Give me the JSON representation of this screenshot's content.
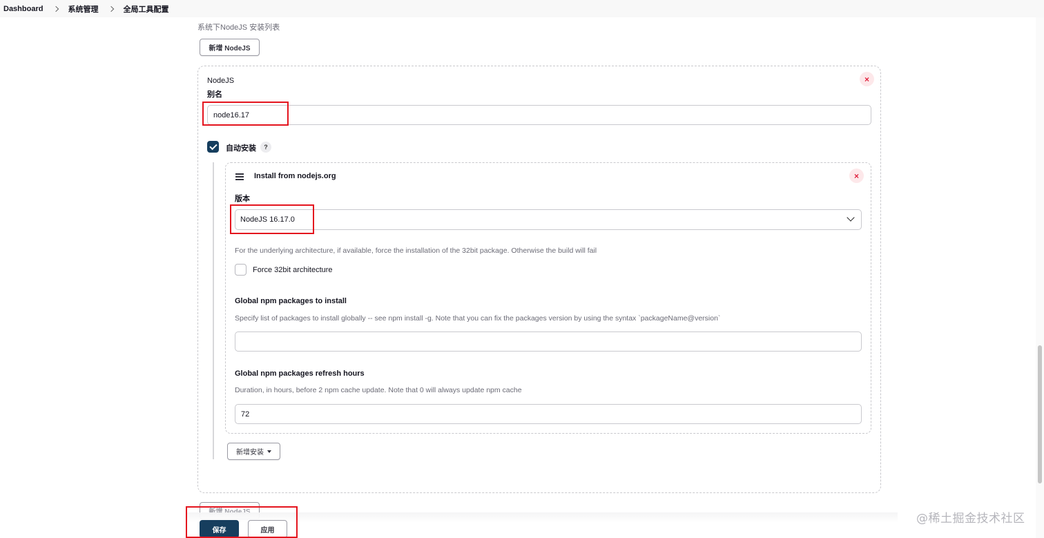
{
  "breadcrumb": {
    "items": [
      "Dashboard",
      "系统管理",
      "全局工具配置"
    ]
  },
  "section": {
    "description": "系统下NodeJS 安装列表",
    "add_button_label": "新增 NodeJS"
  },
  "nodejs_card": {
    "type_label": "NodeJS",
    "alias_label": "别名",
    "alias_value": "node16.17",
    "remove_symbol": "×",
    "auto_install_label": "自动安装",
    "help_symbol": "?"
  },
  "installer": {
    "title": "Install from nodejs.org",
    "remove_symbol": "×",
    "version_label": "版本",
    "version_selected": "NodeJS 16.17.0",
    "arch_description": "For the underlying architecture, if available, force the installation of the 32bit package. Otherwise the build will fail",
    "force32_label": "Force 32bit architecture",
    "force32_checked": false,
    "npm_packages_label": "Global npm packages to install",
    "npm_packages_description": "Specify list of packages to install globally -- see npm install -g. Note that you can fix the packages version by using the syntax `packageName@version`",
    "npm_packages_value": "",
    "refresh_label": "Global npm packages refresh hours",
    "refresh_description": "Duration, in hours, before 2 npm cache update. Note that 0 will always update npm cache",
    "refresh_value": "72",
    "add_installer_label": "新增安装"
  },
  "footer": {
    "add_nodejs_label": "新增 NodeJS",
    "save_label": "保存",
    "apply_label": "应用"
  },
  "watermark": "@稀土掘金技术社区",
  "colors": {
    "primary": "#163e5e",
    "highlight": "#e4141e",
    "danger": "#e0213d"
  }
}
